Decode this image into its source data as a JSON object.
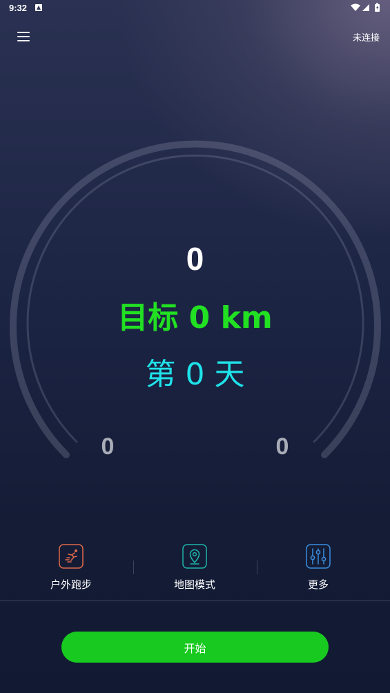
{
  "status_bar": {
    "time": "9:32"
  },
  "app_bar": {
    "connection_status": "未连接"
  },
  "dashboard": {
    "main_value": "0",
    "goal_text": "目标 0 km",
    "day_text": "第 0 天",
    "left_value": "0",
    "right_value": "0"
  },
  "modes": [
    {
      "label": "户外跑步",
      "icon": "outdoor-run-icon",
      "color": "#e06a4a"
    },
    {
      "label": "地图模式",
      "icon": "map-pin-icon",
      "color": "#1fb3a8"
    },
    {
      "label": "更多",
      "icon": "sliders-icon",
      "color": "#3a8ee0"
    }
  ],
  "start_button": {
    "label": "开始"
  },
  "colors": {
    "goal": "#22e022",
    "day": "#1ee3ea",
    "start_button": "#18c91f"
  }
}
